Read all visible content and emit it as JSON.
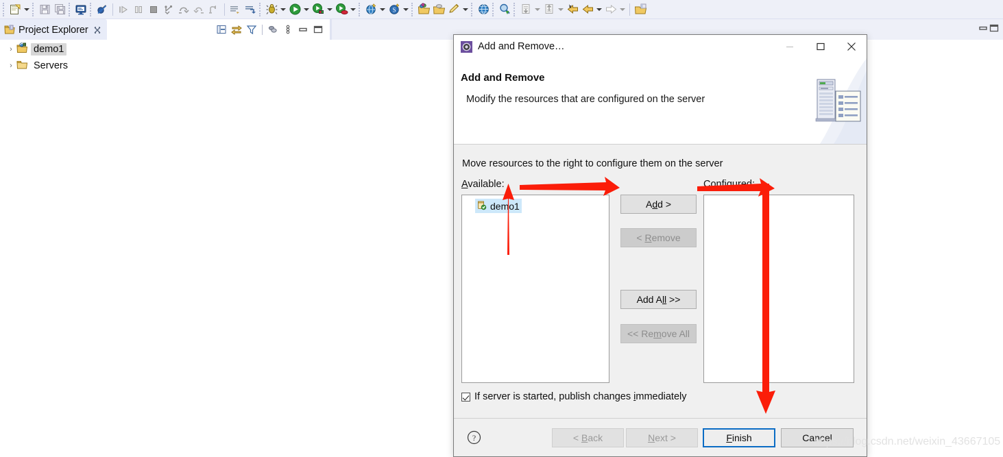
{
  "toolbar": {
    "groups": [
      {
        "items": [
          {
            "name": "new-icon",
            "icon": "new"
          },
          {
            "name": "new-dropdown-caret",
            "icon": "caret"
          }
        ]
      },
      {
        "items": [
          {
            "name": "save-icon",
            "icon": "save"
          },
          {
            "name": "save-all-icon",
            "icon": "save-all"
          }
        ]
      },
      {
        "items": [
          {
            "name": "terminal-icon",
            "icon": "terminal"
          }
        ]
      },
      {
        "items": [
          {
            "name": "skip-breakpoints-icon",
            "icon": "skip-breakpoints"
          }
        ]
      },
      {
        "items": [
          {
            "name": "resume-icon",
            "icon": "resume"
          },
          {
            "name": "suspend-icon",
            "icon": "suspend"
          },
          {
            "name": "terminate-icon",
            "icon": "terminate"
          },
          {
            "name": "step-into-icon",
            "icon": "step-into"
          },
          {
            "name": "step-over-icon",
            "icon": "step-over"
          },
          {
            "name": "step-return-icon",
            "icon": "step-return"
          },
          {
            "name": "drop-to-frame-icon",
            "icon": "drop-to-frame"
          }
        ]
      },
      {
        "items": [
          {
            "name": "next-annotation-icon",
            "icon": "next-annot"
          },
          {
            "name": "previous-annotation-icon",
            "icon": "prev-annot"
          }
        ]
      },
      {
        "items": [
          {
            "name": "debug-icon",
            "icon": "debug"
          },
          {
            "name": "debug-dropdown-caret",
            "icon": "caret"
          },
          {
            "name": "run-icon",
            "icon": "run"
          },
          {
            "name": "run-dropdown-caret",
            "icon": "caret"
          },
          {
            "name": "run-on-server-icon",
            "icon": "run-server"
          },
          {
            "name": "run-on-server-dropdown-caret",
            "icon": "caret"
          },
          {
            "name": "stop-server-icon",
            "icon": "stop-server"
          },
          {
            "name": "stop-server-dropdown-caret",
            "icon": "caret"
          }
        ]
      },
      {
        "items": [
          {
            "name": "new-web-project-icon",
            "icon": "new-web"
          },
          {
            "name": "new-web-project-caret",
            "icon": "caret"
          },
          {
            "name": "new-server-icon",
            "icon": "new-server"
          },
          {
            "name": "new-server-caret",
            "icon": "caret"
          }
        ]
      },
      {
        "items": [
          {
            "name": "open-type-icon",
            "icon": "open-type"
          },
          {
            "name": "open-task-icon",
            "icon": "open-task"
          },
          {
            "name": "new-java-class-icon",
            "icon": "new-class"
          },
          {
            "name": "new-java-class-caret",
            "icon": "caret"
          }
        ]
      },
      {
        "items": [
          {
            "name": "search-icon",
            "icon": "search-globe"
          }
        ]
      },
      {
        "items": [
          {
            "name": "open-search-dialog-icon",
            "icon": "search-dialog"
          }
        ]
      },
      {
        "items": [
          {
            "name": "previous-edit-icon",
            "icon": "prev-edit"
          },
          {
            "name": "previous-edit-caret",
            "icon": "caret"
          },
          {
            "name": "next-edit-icon",
            "icon": "next-edit"
          },
          {
            "name": "next-edit-caret",
            "icon": "caret"
          },
          {
            "name": "back-history-marked-icon",
            "icon": "back-marked"
          },
          {
            "name": "back-history-icon",
            "icon": "back"
          },
          {
            "name": "back-history-caret",
            "icon": "caret"
          },
          {
            "name": "forward-history-icon",
            "icon": "forward"
          },
          {
            "name": "forward-history-caret",
            "icon": "caret"
          }
        ]
      },
      {
        "items": [
          {
            "name": "open-perspective-icon",
            "icon": "open-persp"
          }
        ]
      }
    ]
  },
  "project_explorer": {
    "tab_label": "Project Explorer",
    "toolbar_icons": [
      "collapse-all-icon",
      "link-with-editor-icon",
      "view-menu-filter-icon",
      "focus-on-active-task-icon",
      "view-menu-icon",
      "minimize-view-icon",
      "maximize-view-icon"
    ],
    "tree": [
      {
        "label": "demo1",
        "icon": "java-project-icon",
        "expanded": false,
        "selected": true,
        "twisty": "›"
      },
      {
        "label": "Servers",
        "icon": "folder-icon",
        "expanded": false,
        "selected": false,
        "twisty": "›"
      }
    ]
  },
  "editor_area": {
    "minimize_icon": "minimize-editor-icon",
    "maximize_icon": "maximize-editor-icon"
  },
  "dialog": {
    "title": "Add and Remove…",
    "window_buttons": {
      "minimize": "minimize-window-icon",
      "maximize": "maximize-window-icon",
      "close": "close-window-icon"
    },
    "header_title": "Add and Remove",
    "header_subtitle": "Modify the resources that are configured on the server",
    "banner_icon": "server-and-document-banner-icon",
    "instruction": "Move resources to the right to configure them on the server",
    "available": {
      "label_prefix": "A",
      "label_rest": "vailable:",
      "items": [
        {
          "label": "demo1",
          "icon": "module-icon",
          "selected": true
        }
      ]
    },
    "configured": {
      "label_prefix": "C",
      "label_rest": "onfigured:",
      "items": []
    },
    "transfer_buttons": [
      {
        "name": "add-button",
        "pre": "A",
        "mnemonic": "d",
        "post": "d >",
        "disabled": false
      },
      {
        "name": "remove-button",
        "pre": "< ",
        "mnemonic": "R",
        "post": "emove",
        "disabled": true
      },
      {
        "name": "add-all-button",
        "pre": "Add A",
        "mnemonic": "ll",
        "post": " >>",
        "disabled": false
      },
      {
        "name": "remove-all-button",
        "pre": "<< Re",
        "mnemonic": "m",
        "post": "ove All",
        "disabled": true
      }
    ],
    "publish_checkbox": {
      "checked": true,
      "pre": "If server is started, publish changes ",
      "mnemonic": "i",
      "post": "mmediately"
    },
    "footer": {
      "help_icon": "help-icon",
      "buttons": [
        {
          "name": "back-button",
          "pre": "< ",
          "mnemonic": "B",
          "post": "ack",
          "disabled": true,
          "primary": false
        },
        {
          "name": "next-button",
          "pre": "",
          "mnemonic": "N",
          "post": "ext >",
          "disabled": true,
          "primary": false
        },
        {
          "name": "finish-button",
          "pre": "",
          "mnemonic": "F",
          "post": "inish",
          "disabled": false,
          "primary": true
        },
        {
          "name": "cancel-button",
          "pre": "Cancel",
          "mnemonic": "",
          "post": "",
          "disabled": false,
          "primary": false
        }
      ]
    }
  },
  "annotations": {
    "color": "#fb1d09",
    "arrows": [
      {
        "name": "arrow-up-to-demo1",
        "direction": "up"
      },
      {
        "name": "arrow-right-to-add-button",
        "direction": "right"
      },
      {
        "name": "arrow-right-to-configured",
        "direction": "right"
      },
      {
        "name": "arrow-down-to-finish",
        "direction": "down"
      }
    ]
  },
  "watermark": {
    "text": "https://blog.csdn.net/weixin_43667105"
  }
}
